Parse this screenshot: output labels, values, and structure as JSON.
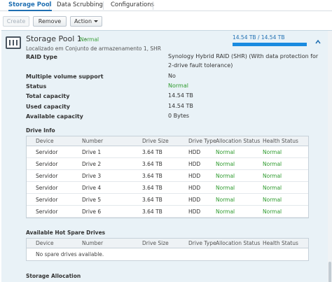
{
  "tabs": [
    {
      "label": "Storage Pool",
      "active": true
    },
    {
      "label": "Data Scrubbing",
      "active": false
    },
    {
      "label": "Configurations",
      "active": false
    }
  ],
  "toolbar": {
    "create_label": "Create",
    "remove_label": "Remove",
    "action_label": "Action"
  },
  "pool": {
    "title": "Storage Pool 1",
    "separator": "-",
    "status": "Normal",
    "subtitle": "Localizado em Conjunto de armazenamento 1, SHR",
    "capacity_text": "14.54 TB / 14.54 TB",
    "capacity_used_fraction": 1.0,
    "properties": [
      {
        "label": "RAID type",
        "value": "Synology Hybrid RAID (SHR) (With data protection for",
        "value2": "2-drive fault tolerance)",
        "status": false
      },
      {
        "label": "Multiple volume support",
        "value": "No",
        "status": false
      },
      {
        "label": "Status",
        "value": "Normal",
        "status": true
      },
      {
        "label": "Total capacity",
        "value": "14.54 TB",
        "status": false
      },
      {
        "label": "Used capacity",
        "value": "14.54 TB",
        "status": false
      },
      {
        "label": "Available capacity",
        "value": "0 Bytes",
        "status": false
      }
    ]
  },
  "drive_info": {
    "title": "Drive Info",
    "columns": [
      "Device",
      "Number",
      "Drive Size",
      "Drive Type",
      "Allocation Status",
      "Health Status"
    ],
    "rows": [
      [
        "Servidor",
        "Drive 1",
        "3.64 TB",
        "HDD",
        "Normal",
        "Normal"
      ],
      [
        "Servidor",
        "Drive 2",
        "3.64 TB",
        "HDD",
        "Normal",
        "Normal"
      ],
      [
        "Servidor",
        "Drive 3",
        "3.64 TB",
        "HDD",
        "Normal",
        "Normal"
      ],
      [
        "Servidor",
        "Drive 4",
        "3.64 TB",
        "HDD",
        "Normal",
        "Normal"
      ],
      [
        "Servidor",
        "Drive 5",
        "3.64 TB",
        "HDD",
        "Normal",
        "Normal"
      ],
      [
        "Servidor",
        "Drive 6",
        "3.64 TB",
        "HDD",
        "Normal",
        "Normal"
      ]
    ]
  },
  "hot_spare": {
    "title": "Available Hot Spare Drives",
    "columns": [
      "Device",
      "Number",
      "Drive Size",
      "Drive Type",
      "Allocation Status",
      "Health Status"
    ],
    "empty_text": "No spare drives available."
  },
  "storage_allocation": {
    "title": "Storage Allocation"
  },
  "colors": {
    "accent": "#1f6fb2",
    "status_normal": "#2e9b2e",
    "panel_bg": "#e9f2f7",
    "capacity_fill": "#1a8be0"
  }
}
